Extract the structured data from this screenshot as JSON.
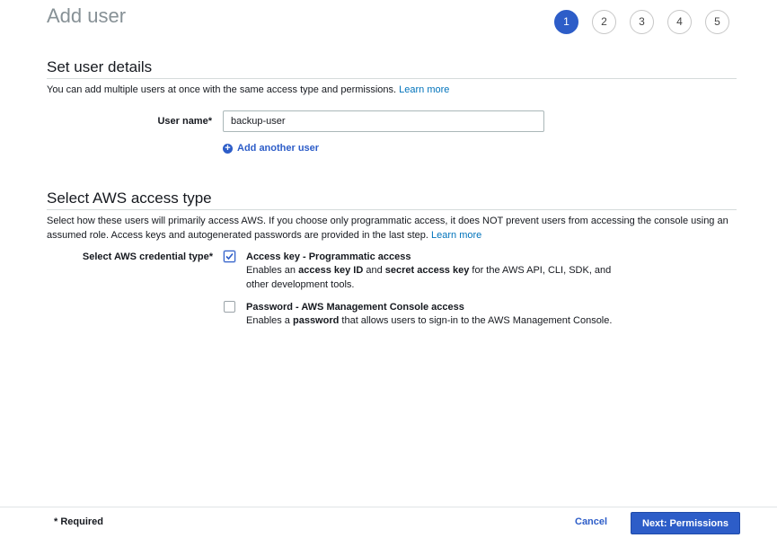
{
  "page": {
    "title": "Add user"
  },
  "wizard": {
    "steps": [
      "1",
      "2",
      "3",
      "4",
      "5"
    ],
    "active_step": 1
  },
  "details": {
    "title": "Set user details",
    "description": "You can add multiple users at once with the same access type and permissions.",
    "learn_more": "Learn more",
    "user_name_label": "User name*",
    "user_name_value": "backup-user",
    "add_another_user": "Add another user"
  },
  "access": {
    "title": "Select AWS access type",
    "description": "Select how these users will primarily access AWS. If you choose only programmatic access, it does NOT prevent users from accessing the console using an assumed role. Access keys and autogenerated passwords are provided in the last step.",
    "learn_more": "Learn more",
    "credential_label": "Select AWS credential type*",
    "options": [
      {
        "title": "Access key - Programmatic access",
        "checked": true,
        "desc_pre": "Enables an ",
        "desc_b1": "access key ID",
        "desc_mid": " and ",
        "desc_b2": "secret access key",
        "desc_post": " for the AWS API, CLI, SDK, and other development tools."
      },
      {
        "title": "Password - AWS Management Console access",
        "checked": false,
        "desc_pre": "Enables a ",
        "desc_b1": "password",
        "desc_post": " that allows users to sign-in to the AWS Management Console."
      }
    ]
  },
  "footer": {
    "required": "* Required",
    "cancel": "Cancel",
    "next": "Next: Permissions"
  },
  "colors": {
    "accent": "#2d5dc8",
    "link": "#0073bb"
  }
}
